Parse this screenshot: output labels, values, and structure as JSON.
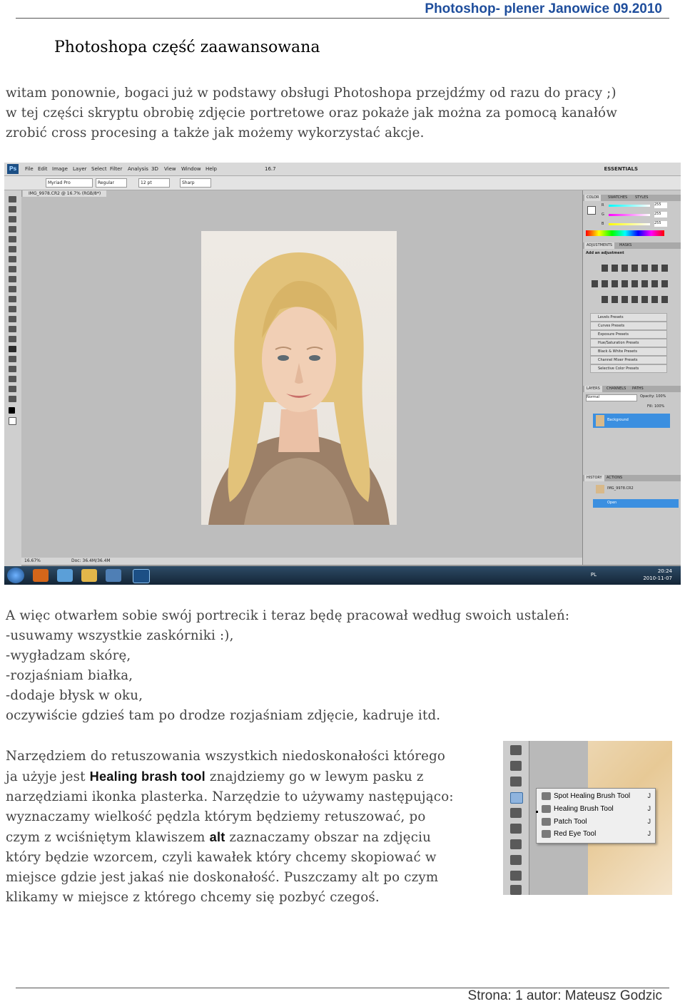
{
  "header": {
    "title": "Photoshop- plener Janowice 09.2010"
  },
  "doc": {
    "title": "Photoshopa część zaawansowana"
  },
  "intro": [
    "witam ponownie, bogaci już w podstawy obsługi Photoshopa przejdźmy od razu do pracy ;)",
    "w tej części skryptu obrobię zdjęcie portretowe oraz pokaże jak można za pomocą kanałów",
    "zrobić cross procesing a także jak możemy wykorzystać akcje."
  ],
  "screenshot": {
    "menu": [
      "File",
      "Edit",
      "Image",
      "Layer",
      "Select",
      "Filter",
      "Analysis",
      "3D",
      "View",
      "Window",
      "Help"
    ],
    "workspace": "ESSENTIALS",
    "font_family": "Myriad Pro",
    "font_style": "Regular",
    "font_size": "12 pt",
    "aa_mode": "Sharp",
    "zoom_box": "16.7",
    "doc_tab": "IMG_9978.CR2 @ 16.7% (RGB/8*)",
    "status_zoom": "16.67%",
    "status_doc": "Doc: 36.4M/36.4M",
    "color_tabs": [
      "COLOR",
      "SWATCHES",
      "STYLES"
    ],
    "rgb": [
      {
        "ch": "R",
        "val": "255"
      },
      {
        "ch": "G",
        "val": "255"
      },
      {
        "ch": "B",
        "val": "255"
      }
    ],
    "adj_tabs": [
      "ADJUSTMENTS",
      "MASKS"
    ],
    "adj_label": "Add an adjustment",
    "presets": [
      "Levels Presets",
      "Curves Presets",
      "Exposure Presets",
      "Hue/Saturation Presets",
      "Black & White Presets",
      "Channel Mixer Presets",
      "Selective Color Presets"
    ],
    "layer_tabs": [
      "LAYERS",
      "CHANNELS",
      "PATHS"
    ],
    "blend_mode": "Normal",
    "opacity": "Opacity: 100%",
    "fill": "Fill: 100%",
    "layer_name": "Background",
    "history_tabs": [
      "HISTORY",
      "ACTIONS"
    ],
    "history_doc": "IMG_9978.CR2",
    "history_step": "Open",
    "taskbar_lang": "PL",
    "clock_time": "20:24",
    "clock_date": "2010-11-07"
  },
  "list_block": [
    "A więc otwarłem sobie swój portrecik i teraz będę pracował według swoich ustaleń:",
    "-usuwamy wszystkie zaskórniki :),",
    "-wygładzam skórę,",
    "-rozjaśniam białka,",
    "-dodaje błysk w oku,",
    "oczywiście gdzieś tam po drodze rozjaśniam zdjęcie, kadruje itd."
  ],
  "body": {
    "p1": "Narzędziem do retuszowania wszystkich niedoskonałości którego",
    "p2a": "ja użyje jest ",
    "p2b": "Healing brash tool",
    "p2c": " znajdziemy go w lewym pasku z",
    "p3": "narzędziami ikonka plasterka. Narzędzie to używamy następująco:",
    "p4": "wyznaczamy wielkość pędzla którym będziemy retuszować, po",
    "p5a": "czym z wciśniętym klawiszem ",
    "p5b": "alt",
    "p5c": " zaznaczamy obszar na zdjęciu",
    "p6": "który będzie wzorcem, czyli kawałek który chcemy skopiować w",
    "p7": "miejsce gdzie jest jakaś nie doskonałość. Puszczamy alt po czym",
    "p8": "klikamy w miejsce z którego chcemy się pozbyć czegoś."
  },
  "flyout": [
    {
      "label": "Spot Healing Brush Tool",
      "key": "J"
    },
    {
      "label": "Healing Brush Tool",
      "key": "J"
    },
    {
      "label": "Patch Tool",
      "key": "J"
    },
    {
      "label": "Red Eye Tool",
      "key": "J"
    }
  ],
  "footer": {
    "text": "Strona: 1 autor: Mateusz Godzic"
  }
}
